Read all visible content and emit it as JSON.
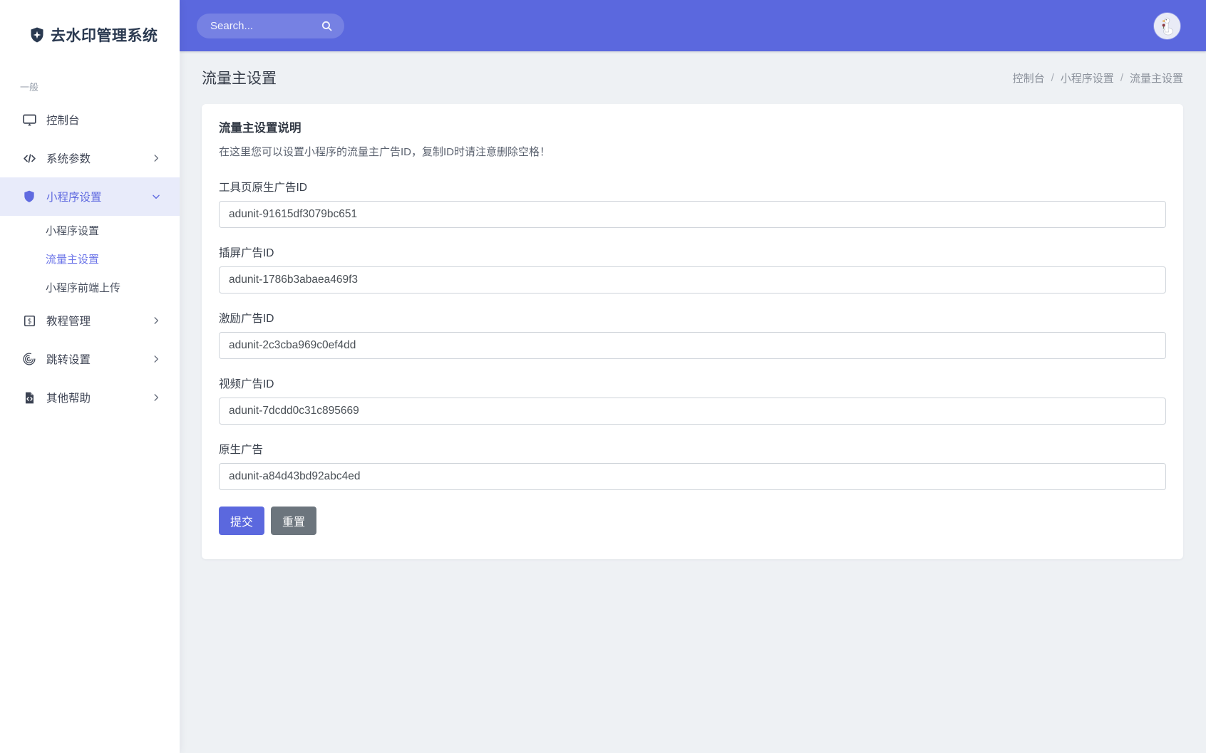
{
  "app": {
    "title": "去水印管理系统"
  },
  "header": {
    "search_placeholder": "Search..."
  },
  "sidebar": {
    "section_label": "一般",
    "items": [
      {
        "label": "控制台",
        "icon": "desktop-icon"
      },
      {
        "label": "系统参数",
        "icon": "code-icon",
        "chevron": "right"
      },
      {
        "label": "小程序设置",
        "icon": "shield-icon",
        "chevron": "down",
        "active": true
      },
      {
        "label": "教程管理",
        "icon": "dollar-square-icon",
        "chevron": "right"
      },
      {
        "label": "跳转设置",
        "icon": "fingerprint-icon",
        "chevron": "right"
      },
      {
        "label": "其他帮助",
        "icon": "file-code-icon",
        "chevron": "right"
      }
    ],
    "subitems": [
      {
        "label": "小程序设置",
        "active": false
      },
      {
        "label": "流量主设置",
        "active": true
      },
      {
        "label": "小程序前端上传",
        "active": false
      }
    ]
  },
  "page": {
    "title": "流量主设置",
    "breadcrumb": [
      "控制台",
      "小程序设置",
      "流量主设置"
    ],
    "breadcrumb_separator": "/"
  },
  "form": {
    "heading": "流量主设置说明",
    "description": "在这里您可以设置小程序的流量主广告ID，复制ID时请注意删除空格！",
    "fields": [
      {
        "label": "工具页原生广告ID",
        "value": "adunit-91615df3079bc651"
      },
      {
        "label": "插屏广告ID",
        "value": "adunit-1786b3abaea469f3"
      },
      {
        "label": "激励广告ID",
        "value": "adunit-2c3cba969c0ef4dd"
      },
      {
        "label": "视频广告ID",
        "value": "adunit-7dcdd0c31c895669"
      },
      {
        "label": "原生广告",
        "value": "adunit-a84d43bd92abc4ed"
      }
    ],
    "submit_label": "提交",
    "reset_label": "重置"
  },
  "colors": {
    "accent": "#5b68de",
    "header_bg": "#5b68de",
    "sidebar_active_bg": "#e8ebfa",
    "sidebar_active_text": "#5f6ae0",
    "page_bg": "#eef1f4",
    "submit_button": "#5b68de",
    "reset_button": "#6c757d"
  }
}
